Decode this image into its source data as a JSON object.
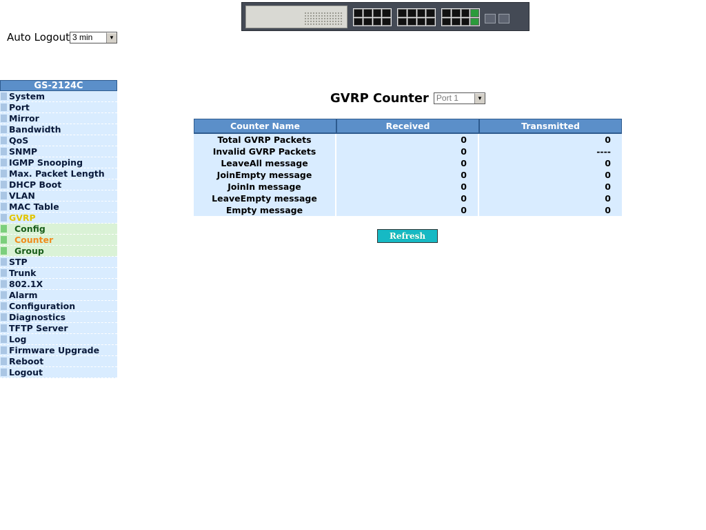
{
  "auto_logout": {
    "label": "Auto Logout",
    "selected": "3 min"
  },
  "sidebar": {
    "title": "GS-2124C",
    "items": [
      {
        "label": "System",
        "kind": "item"
      },
      {
        "label": "Port",
        "kind": "item"
      },
      {
        "label": "Mirror",
        "kind": "item"
      },
      {
        "label": "Bandwidth",
        "kind": "item"
      },
      {
        "label": "QoS",
        "kind": "item"
      },
      {
        "label": "SNMP",
        "kind": "item"
      },
      {
        "label": "IGMP Snooping",
        "kind": "item"
      },
      {
        "label": "Max. Packet Length",
        "kind": "item"
      },
      {
        "label": "DHCP Boot",
        "kind": "item"
      },
      {
        "label": "VLAN",
        "kind": "item"
      },
      {
        "label": "MAC Table",
        "kind": "item"
      },
      {
        "label": "GVRP",
        "kind": "active"
      },
      {
        "label": "Config",
        "kind": "sub"
      },
      {
        "label": "Counter",
        "kind": "sub-current"
      },
      {
        "label": "Group",
        "kind": "sub"
      },
      {
        "label": "STP",
        "kind": "item"
      },
      {
        "label": "Trunk",
        "kind": "item"
      },
      {
        "label": "802.1X",
        "kind": "item"
      },
      {
        "label": "Alarm",
        "kind": "item"
      },
      {
        "label": "Configuration",
        "kind": "item"
      },
      {
        "label": "Diagnostics",
        "kind": "item"
      },
      {
        "label": "TFTP Server",
        "kind": "item"
      },
      {
        "label": "Log",
        "kind": "item"
      },
      {
        "label": "Firmware Upgrade",
        "kind": "item"
      },
      {
        "label": "Reboot",
        "kind": "item"
      },
      {
        "label": "Logout",
        "kind": "item"
      }
    ]
  },
  "main": {
    "title": "GVRP Counter",
    "port_selected": "Port 1",
    "table": {
      "headers": [
        "Counter Name",
        "Received",
        "Transmitted"
      ],
      "rows": [
        [
          "Total GVRP Packets",
          "0",
          "0"
        ],
        [
          "Invalid GVRP Packets",
          "0",
          "----"
        ],
        [
          "LeaveAll message",
          "0",
          "0"
        ],
        [
          "JoinEmpty message",
          "0",
          "0"
        ],
        [
          "JoinIn message",
          "0",
          "0"
        ],
        [
          "LeaveEmpty message",
          "0",
          "0"
        ],
        [
          "Empty message",
          "0",
          "0"
        ]
      ]
    },
    "refresh_label": "Refresh"
  },
  "colors": {
    "header_blue": "#5b8fc9",
    "row_light_blue": "#d9ecff",
    "sub_green": "#daf2d6",
    "active_yellow": "#e2c500",
    "current_orange": "#f08c1e",
    "refresh_cyan": "#16b9c4"
  }
}
